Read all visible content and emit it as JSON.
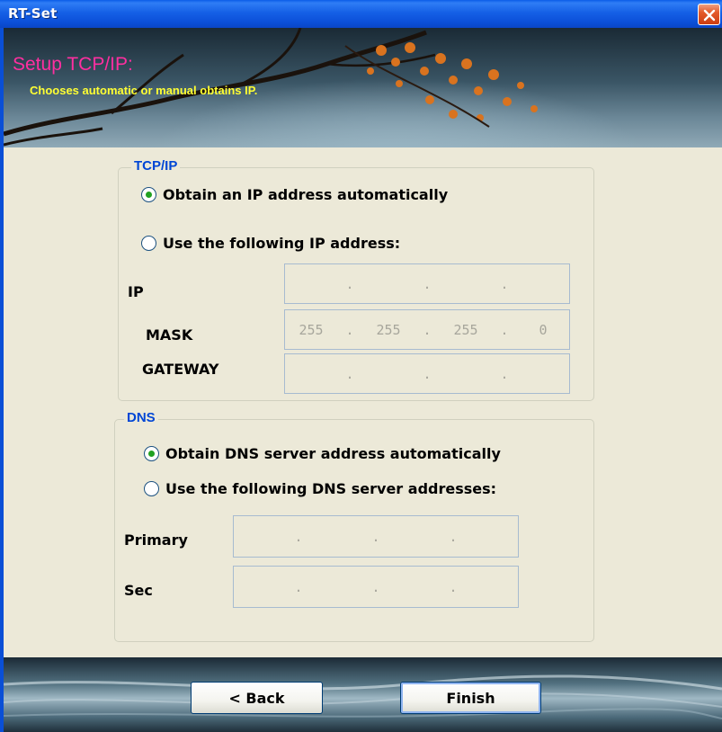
{
  "window": {
    "title": "RT-Set",
    "close_icon": "close-icon"
  },
  "header": {
    "title": "Setup TCP/IP:",
    "subtitle": "Chooses automatic or manual obtains IP."
  },
  "tcpip": {
    "legend": "TCP/IP",
    "auto_label": "Obtain an IP address automatically",
    "manual_label": "Use the following IP address:",
    "selected": "auto",
    "fields": [
      {
        "label": "IP",
        "octets": [
          "",
          "",
          "",
          ""
        ]
      },
      {
        "label": "MASK",
        "octets": [
          "255",
          "255",
          "255",
          "0"
        ]
      },
      {
        "label": "GATEWAY",
        "octets": [
          "",
          "",
          "",
          ""
        ]
      }
    ]
  },
  "dns": {
    "legend": "DNS",
    "auto_label": "Obtain DNS server address automatically",
    "manual_label": "Use the following DNS server addresses:",
    "selected": "auto",
    "fields": [
      {
        "label": "Primary",
        "octets": [
          "",
          "",
          "",
          ""
        ]
      },
      {
        "label": "Sec",
        "octets": [
          "",
          "",
          "",
          ""
        ]
      }
    ]
  },
  "buttons": {
    "back_label": "< Back",
    "finish_label": "Finish"
  },
  "colors": {
    "title_bar": "#0b4fd8",
    "header_title": "#ff2fa0",
    "header_subtitle": "#ffff33",
    "group_legend": "#0046d5",
    "panel_bg": "#ece9d8",
    "radio_dot": "#21a121"
  }
}
